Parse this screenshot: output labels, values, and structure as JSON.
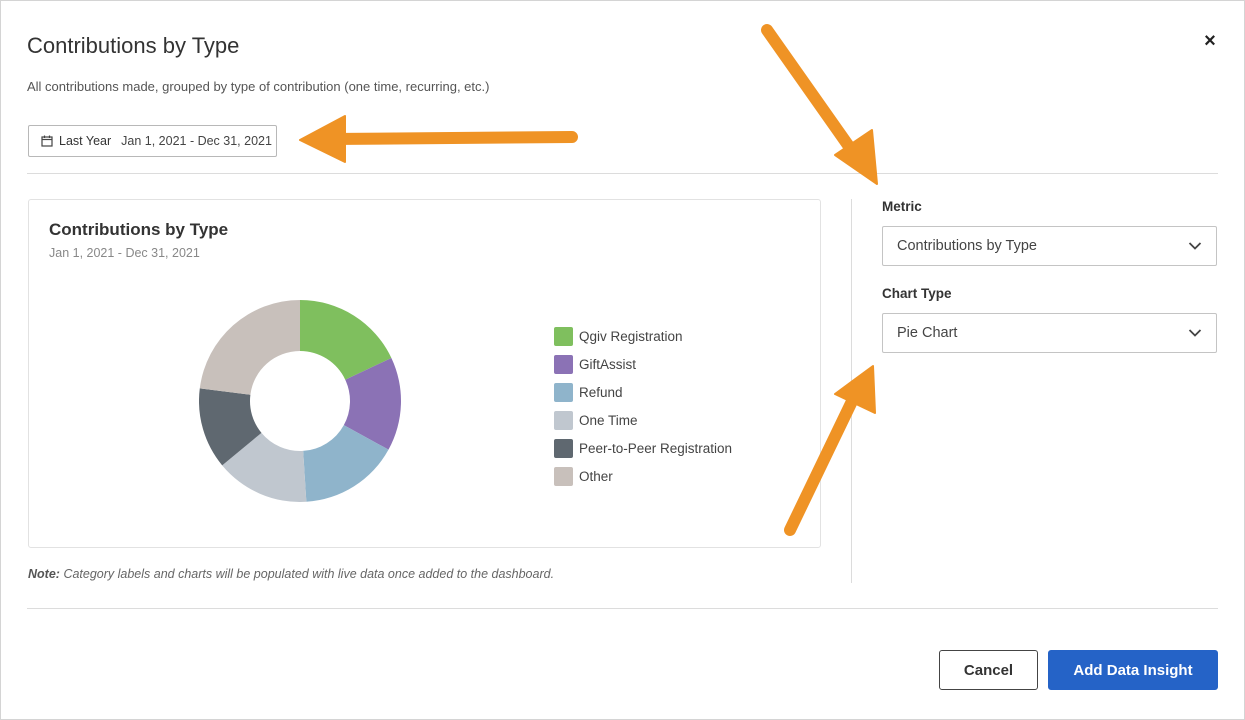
{
  "dialog": {
    "title": "Contributions by Type",
    "subtitle": "All contributions made, grouped by type of contribution (one time, recurring, etc.)",
    "close_label": "×"
  },
  "date_filter": {
    "preset": "Last Year",
    "range": "Jan 1, 2021 - Dec 31, 2021"
  },
  "preview": {
    "title": "Contributions by Type",
    "date_range": "Jan 1, 2021 - Dec 31, 2021"
  },
  "chart_data": {
    "type": "pie",
    "categories": [
      "Qgiv Registration",
      "GiftAssist",
      "Refund",
      "One Time",
      "Peer-to-Peer Registration",
      "Other"
    ],
    "values": [
      18,
      15,
      16,
      15,
      13,
      23
    ],
    "colors": [
      "#7fbf5e",
      "#8b72b5",
      "#8fb4cb",
      "#c0c7cf",
      "#5f6870",
      "#c8c0bb"
    ],
    "donut": true,
    "legend_position": "right"
  },
  "note": {
    "label": "Note:",
    "text": "Category labels and charts will be populated with live data once added to the dashboard."
  },
  "settings": {
    "metric_label": "Metric",
    "metric_value": "Contributions by Type",
    "chart_type_label": "Chart Type",
    "chart_type_value": "Pie Chart"
  },
  "footer": {
    "cancel_label": "Cancel",
    "add_label": "Add Data Insight"
  },
  "annotation_color": "#ef9325"
}
